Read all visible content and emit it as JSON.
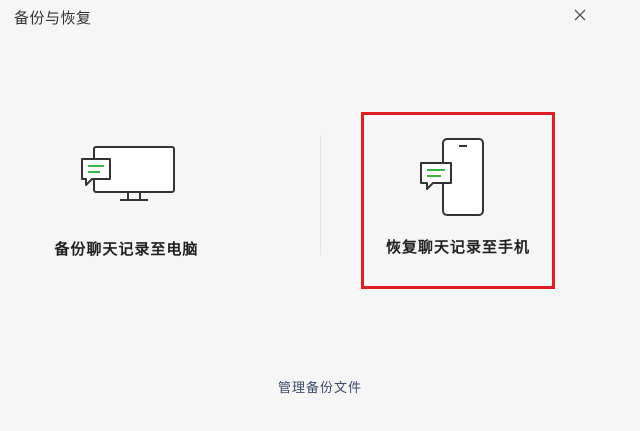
{
  "window": {
    "title": "备份与恢复"
  },
  "icons": {
    "close": "close-icon",
    "computer": "computer-chat-icon",
    "phone": "phone-chat-icon"
  },
  "options": {
    "backup_to_pc": {
      "label": "备份聊天记录至电脑"
    },
    "restore_to_phone": {
      "label": "恢复聊天记录至手机"
    }
  },
  "footer": {
    "manage_label": "管理备份文件"
  },
  "colors": {
    "background": "#f6f6f6",
    "accent_green": "#3bb54a",
    "highlight_red": "#e11e21",
    "link": "#3a4a6b"
  }
}
